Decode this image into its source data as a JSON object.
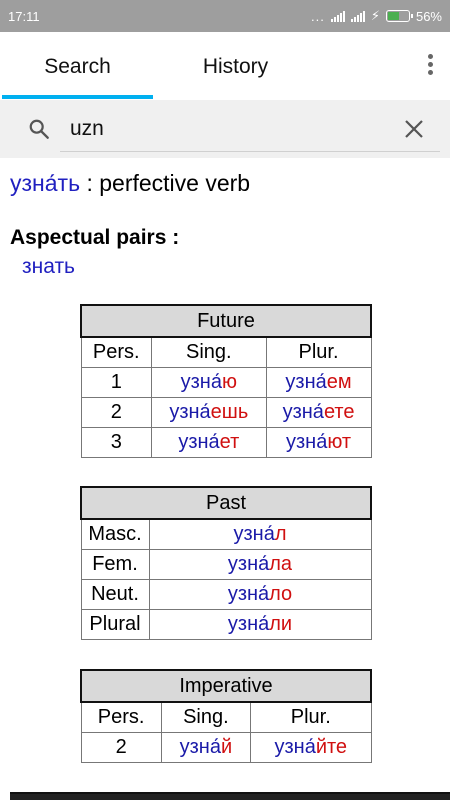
{
  "status": {
    "time": "17:11",
    "dots": "...",
    "battery": "56%",
    "battery_level": 0.56,
    "battery_color": "#4caf50"
  },
  "tabs": {
    "search": "Search",
    "history": "History",
    "active_color": "#00b0f0"
  },
  "search": {
    "value": "uzn",
    "placeholder": ""
  },
  "entry": {
    "word": "узна́ть",
    "pos": " : perfective verb"
  },
  "aspect": {
    "title": "Aspectual pairs :",
    "pair": "знать"
  },
  "future": {
    "title": "Future",
    "headers": [
      "Pers.",
      "Sing.",
      "Plur."
    ],
    "rows": [
      {
        "pers": "1",
        "sing_stem": "узна́",
        "sing_end": "ю",
        "plur_stem": "узна́",
        "plur_end": "ем"
      },
      {
        "pers": "2",
        "sing_stem": "узна́",
        "sing_end": "ешь",
        "plur_stem": "узна́",
        "plur_end": "ете"
      },
      {
        "pers": "3",
        "sing_stem": "узна́",
        "sing_end": "ет",
        "plur_stem": "узна́",
        "plur_end": "ют"
      }
    ]
  },
  "past": {
    "title": "Past",
    "rows": [
      {
        "label": "Masc.",
        "stem": "узна́",
        "end": "л"
      },
      {
        "label": "Fem.",
        "stem": "узна́",
        "end": "ла"
      },
      {
        "label": "Neut.",
        "stem": "узна́",
        "end": "ло"
      },
      {
        "label": "Plural",
        "stem": "узна́",
        "end": "ли"
      }
    ]
  },
  "imperative": {
    "title": "Imperative",
    "headers": [
      "Pers.",
      "Sing.",
      "Plur."
    ],
    "rows": [
      {
        "pers": "2",
        "sing_stem": "узна́",
        "sing_end": "й",
        "plur_stem": "узна́",
        "plur_end": "йте"
      }
    ]
  },
  "colors": {
    "stem": "#1a1aa8",
    "ending": "#d01010",
    "word": "#2020c0"
  }
}
